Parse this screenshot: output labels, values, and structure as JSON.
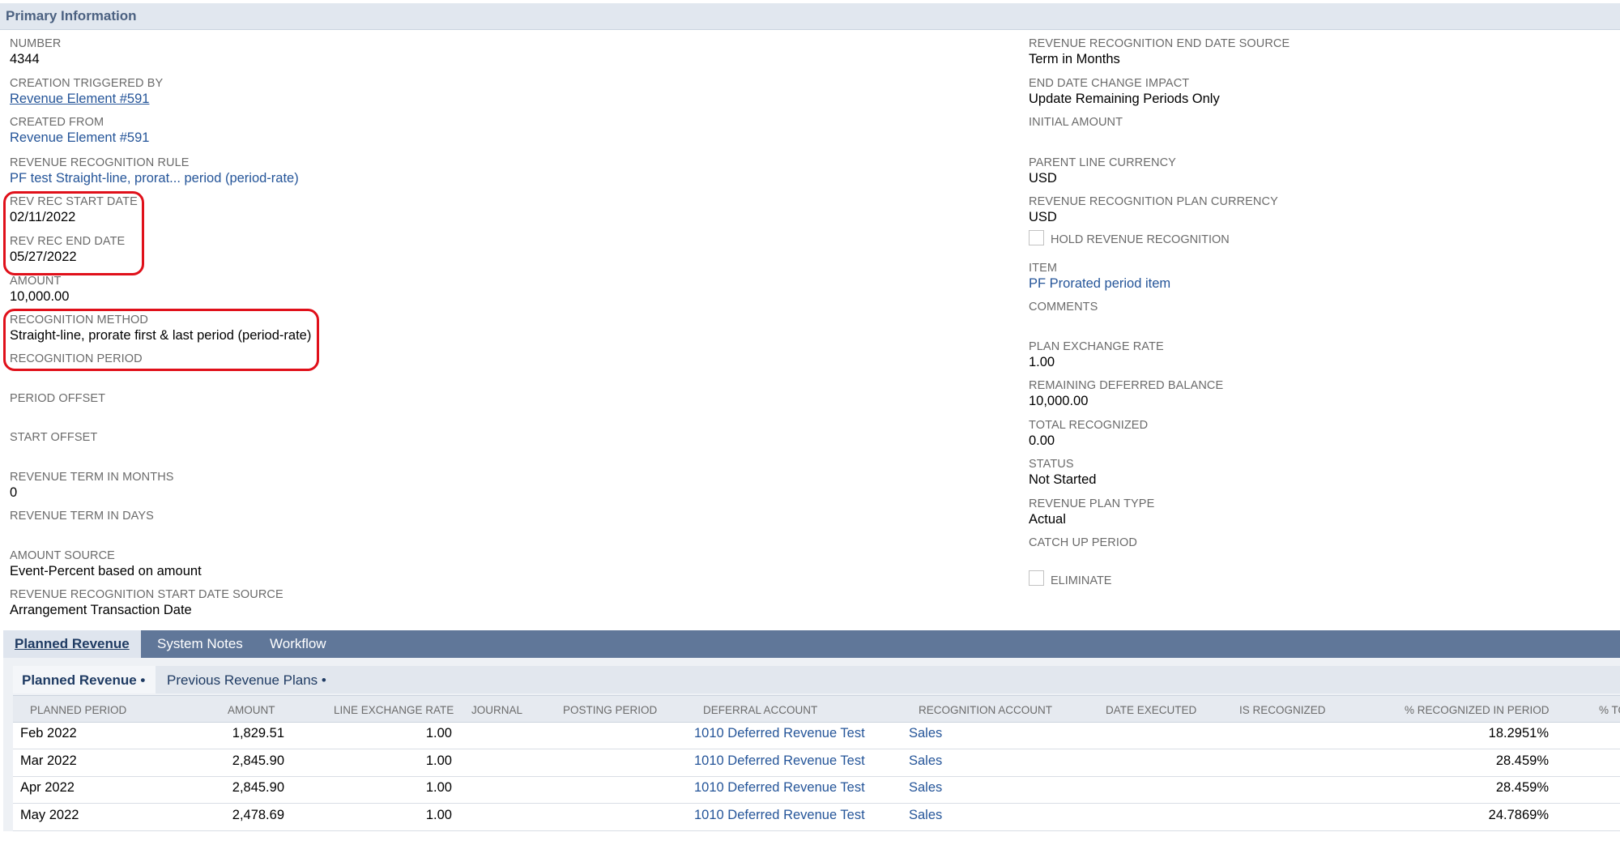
{
  "section_title": "Primary Information",
  "left_fields": [
    {
      "label": "NUMBER",
      "value": "4344"
    },
    {
      "label": "CREATION TRIGGERED BY",
      "value": "Revenue Element #591"
    },
    {
      "label": "CREATED FROM",
      "value": "Revenue Element #591"
    },
    {
      "label": "REVENUE RECOGNITION RULE",
      "value": "PF test Straight-line, prorat... period (period-rate)"
    },
    {
      "label": "REV REC START DATE",
      "value": "02/11/2022"
    },
    {
      "label": "REV REC END DATE",
      "value": "05/27/2022"
    },
    {
      "label": "AMOUNT",
      "value": "10,000.00"
    },
    {
      "label": "RECOGNITION METHOD",
      "value": "Straight-line, prorate first & last period (period-rate)"
    },
    {
      "label": "RECOGNITION PERIOD",
      "value": ""
    },
    {
      "label": "PERIOD OFFSET",
      "value": ""
    },
    {
      "label": "START OFFSET",
      "value": ""
    },
    {
      "label": "REVENUE TERM IN MONTHS",
      "value": "0"
    },
    {
      "label": "REVENUE TERM IN DAYS",
      "value": ""
    },
    {
      "label": "AMOUNT SOURCE",
      "value": "Event-Percent based on amount"
    },
    {
      "label": "REVENUE RECOGNITION START DATE SOURCE",
      "value": "Arrangement Transaction Date"
    }
  ],
  "right_fields": [
    {
      "label": "REVENUE RECOGNITION END DATE SOURCE",
      "value": "Term in Months"
    },
    {
      "label": "END DATE CHANGE IMPACT",
      "value": "Update Remaining Periods Only"
    },
    {
      "label": "INITIAL AMOUNT",
      "value": ""
    },
    {
      "label": "PARENT LINE CURRENCY",
      "value": "USD"
    },
    {
      "label": "REVENUE RECOGNITION PLAN CURRENCY",
      "value": "USD"
    },
    {
      "label": "HOLD REVENUE RECOGNITION",
      "value": ""
    },
    {
      "label": "ITEM",
      "value": "PF Prorated period item"
    },
    {
      "label": "COMMENTS",
      "value": ""
    },
    {
      "label": "PLAN EXCHANGE RATE",
      "value": "1.00"
    },
    {
      "label": "REMAINING DEFERRED BALANCE",
      "value": "10,000.00"
    },
    {
      "label": "TOTAL RECOGNIZED",
      "value": "0.00"
    },
    {
      "label": "STATUS",
      "value": "Not Started"
    },
    {
      "label": "REVENUE PLAN TYPE",
      "value": "Actual"
    },
    {
      "label": "CATCH UP PERIOD",
      "value": ""
    },
    {
      "label": "ELIMINATE",
      "value": ""
    }
  ],
  "tabs": [
    "Planned Revenue",
    "System Notes",
    "Workflow"
  ],
  "subtabs": [
    "Planned Revenue •",
    "Previous Revenue Plans •"
  ],
  "grid": {
    "headers": [
      "PLANNED PERIOD",
      "AMOUNT",
      "LINE EXCHANGE RATE",
      "JOURNAL",
      "POSTING PERIOD",
      "DEFERRAL ACCOUNT",
      "RECOGNITION ACCOUNT",
      "DATE EXECUTED",
      "IS RECOGNIZED",
      "% RECOGNIZED IN PERIOD",
      "% TO"
    ],
    "rows": [
      {
        "period": "Feb 2022",
        "amount": "1,829.51",
        "rate": "1.00",
        "deferral": "1010 Deferred Revenue Test",
        "recognition": "Sales",
        "pct": "18.2951%"
      },
      {
        "period": "Mar 2022",
        "amount": "2,845.90",
        "rate": "1.00",
        "deferral": "1010 Deferred Revenue Test",
        "recognition": "Sales",
        "pct": "28.459%"
      },
      {
        "period": "Apr 2022",
        "amount": "2,845.90",
        "rate": "1.00",
        "deferral": "1010 Deferred Revenue Test",
        "recognition": "Sales",
        "pct": "28.459%"
      },
      {
        "period": "May 2022",
        "amount": "2,478.69",
        "rate": "1.00",
        "deferral": "1010 Deferred Revenue Test",
        "recognition": "Sales",
        "pct": "24.7869%"
      }
    ]
  }
}
